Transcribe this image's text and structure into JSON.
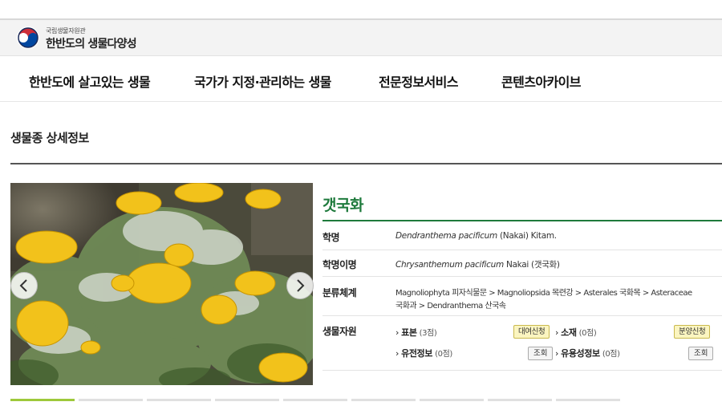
{
  "header": {
    "org_name": "국립생물자원관",
    "site_title": "한반도의 생물다양성"
  },
  "gnb": {
    "items": [
      "한반도에 살고있는 생물",
      "국가가 지정·관리하는 생물",
      "전문정보서비스",
      "콘텐츠아카이브"
    ]
  },
  "page": {
    "title": "생물종 상세정보"
  },
  "species": {
    "korean_name": "갯국화",
    "rows": {
      "sci_name_label": "학명",
      "sci_name_italic": "Dendranthema pacificum",
      "sci_name_author": " (Nakai) Kitam.",
      "synonym_label": "학명이명",
      "synonym_italic": "Chrysanthemum pacificum",
      "synonym_rest": " Nakai (갯국화)",
      "taxonomy_label": "분류체계",
      "taxonomy_line1": "Magnoliophyta 피자식물문 > Magnoliopsida 목련강 > Asterales 국화목 > Asteraceae",
      "taxonomy_line2": "국화과 > Dendranthema 산국속",
      "resources_label": "생물자원"
    },
    "resources": {
      "specimen_label": "표본",
      "specimen_count": "(3점)",
      "specimen_button": "대여신청",
      "material_label": "소재",
      "material_count": "(0점)",
      "material_button": "분양신청",
      "genetic_label": "유전정보",
      "genetic_count": "(0점)",
      "genetic_button": "조회",
      "useful_label": "유용성정보",
      "useful_count": "(0점)",
      "useful_button": "조회"
    }
  },
  "icons": {
    "logo": "taegeuk-logo-icon",
    "prev": "chevron-left-icon",
    "next": "chevron-right-icon",
    "bullet": "chevron-right-bullet-icon"
  },
  "colors": {
    "accent_green": "#1e7a3c",
    "button_yellow": "#fbf5c0",
    "thumb_active": "#9ec93b"
  }
}
